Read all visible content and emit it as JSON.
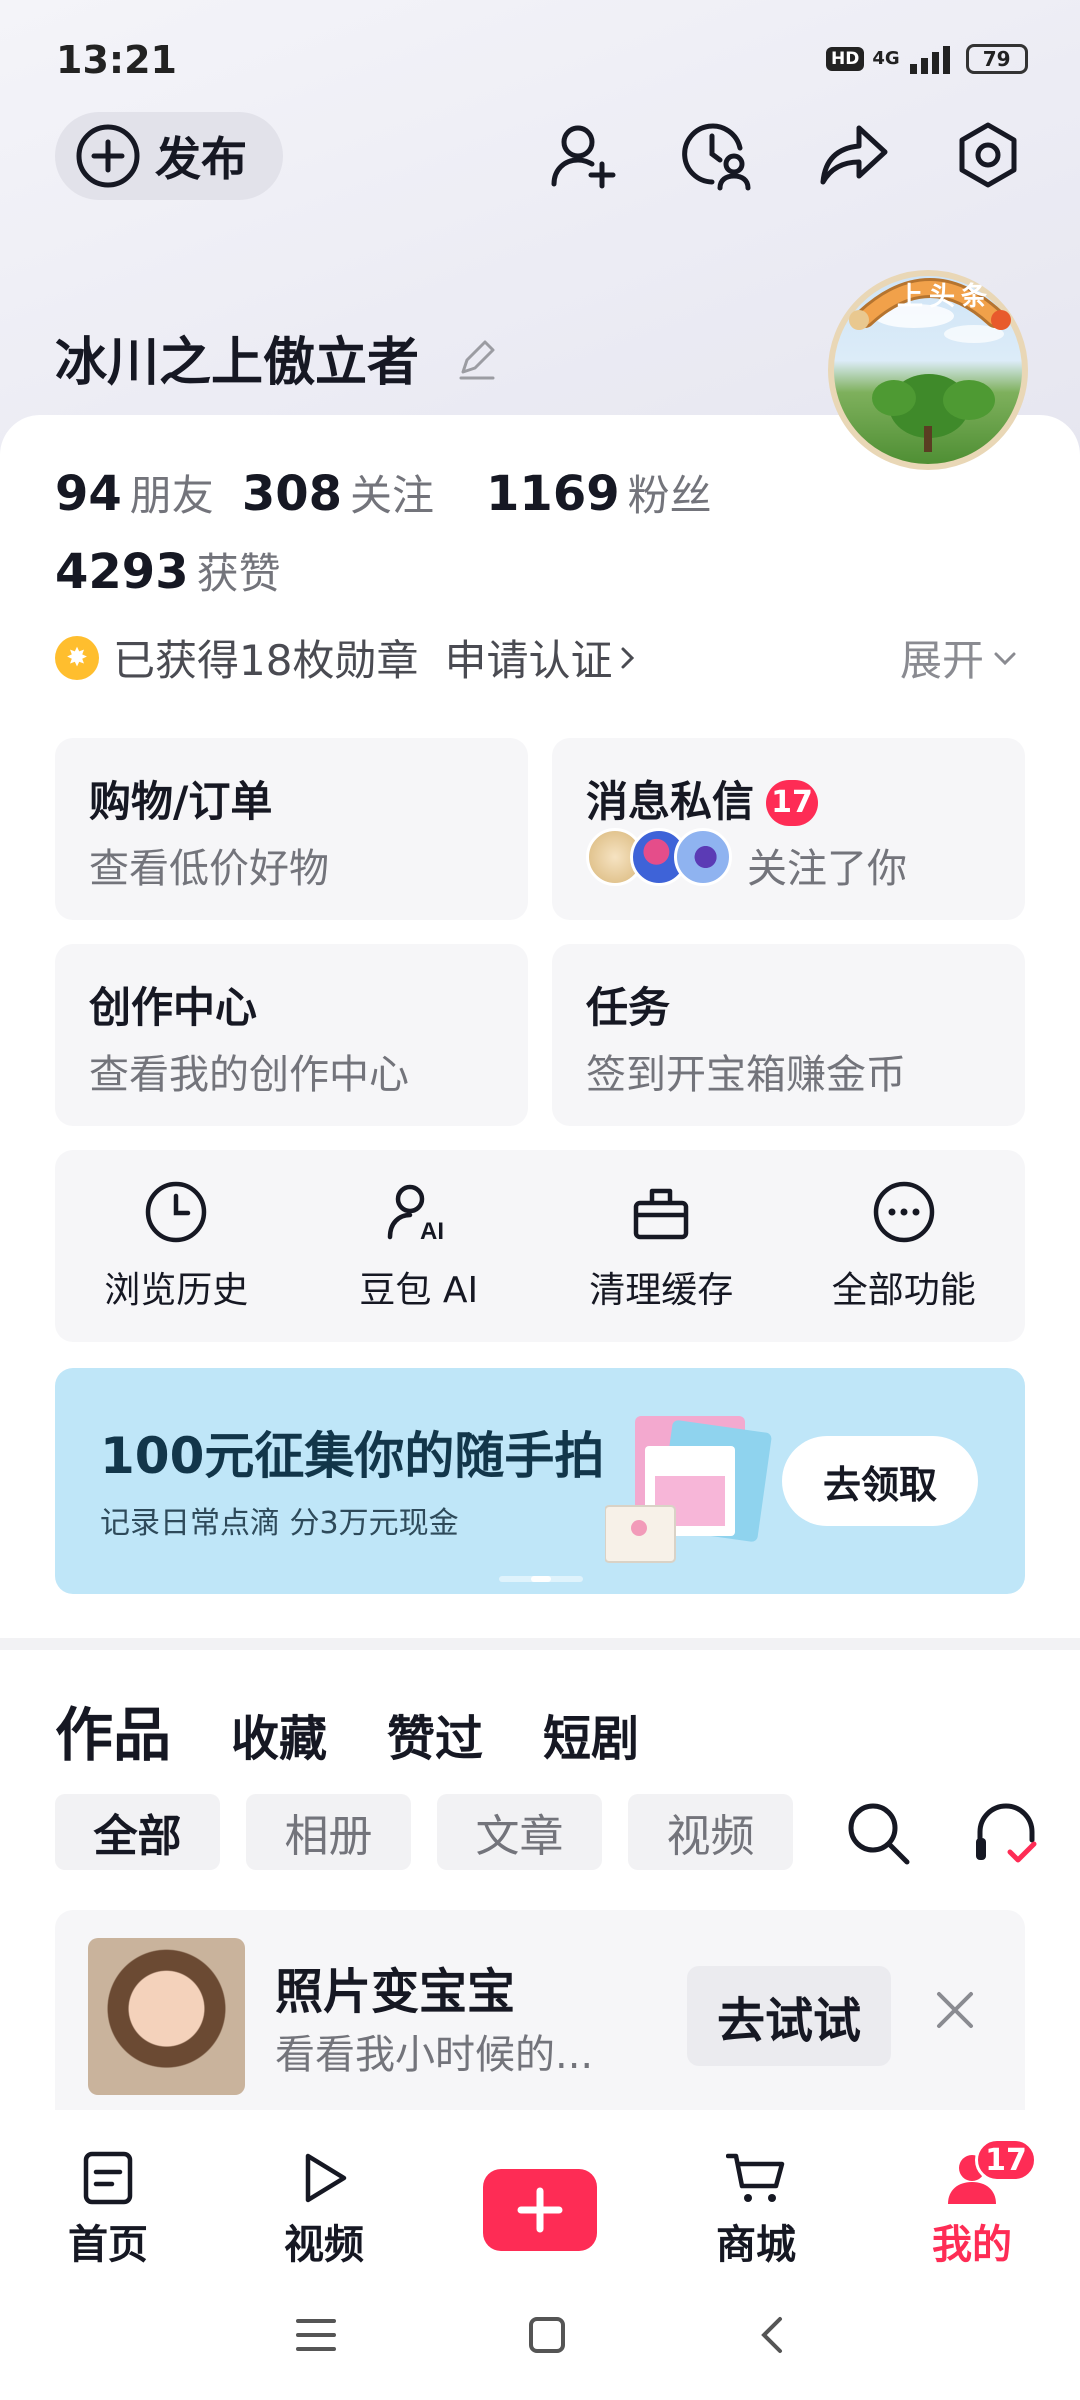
{
  "status": {
    "time": "13:21",
    "hd": "HD",
    "net": "4G",
    "battery": "79"
  },
  "header": {
    "publish_label": "发布",
    "icons": [
      "add-friend-icon",
      "visitor-history-icon",
      "share-icon",
      "settings-icon"
    ]
  },
  "profile": {
    "name": "冰川之上傲立者",
    "avatar_badge": "上头条",
    "friends": {
      "count": "94",
      "label": "朋友"
    },
    "following": {
      "count": "308",
      "label": "关注"
    },
    "followers": {
      "count": "1169",
      "label": "粉丝"
    },
    "likes": {
      "count": "4293",
      "label": "获赞"
    },
    "medals_text": "已获得18枚勋章",
    "verify_text": "申请认证",
    "expand_text": "展开"
  },
  "tiles": [
    {
      "title": "购物/订单",
      "subtitle": "查看低价好物"
    },
    {
      "title": "消息私信",
      "badge": "17",
      "subtitle": "关注了你"
    },
    {
      "title": "创作中心",
      "subtitle": "查看我的创作中心"
    },
    {
      "title": "任务",
      "subtitle": "签到开宝箱赚金币"
    }
  ],
  "tools": [
    {
      "label": "浏览历史",
      "icon": "clock-icon"
    },
    {
      "label": "豆包 AI",
      "icon": "ai-assistant-icon"
    },
    {
      "label": "清理缓存",
      "icon": "cleanup-icon"
    },
    {
      "label": "全部功能",
      "icon": "more-icon"
    }
  ],
  "banner": {
    "title": "100元征集你的随手拍",
    "subtitle": "记录日常点滴 分3万元现金",
    "button": "去领取"
  },
  "content_tabs": [
    "作品",
    "收藏",
    "赞过",
    "短剧"
  ],
  "filter_chips": [
    "全部",
    "相册",
    "文章",
    "视频"
  ],
  "promo": {
    "title": "照片变宝宝",
    "subtitle": "看看我小时候的...",
    "button": "去试试"
  },
  "bottom_nav": [
    {
      "label": "首页",
      "icon": "home-icon"
    },
    {
      "label": "视频",
      "icon": "play-icon"
    },
    {
      "label": "",
      "icon": "plus-icon"
    },
    {
      "label": "商城",
      "icon": "cart-icon"
    },
    {
      "label": "我的",
      "icon": "user-icon",
      "badge": "17"
    }
  ],
  "colors": {
    "accent": "#fe2c55",
    "banner_bg": "#bfe6f8",
    "medal": "#ffbe2e"
  }
}
